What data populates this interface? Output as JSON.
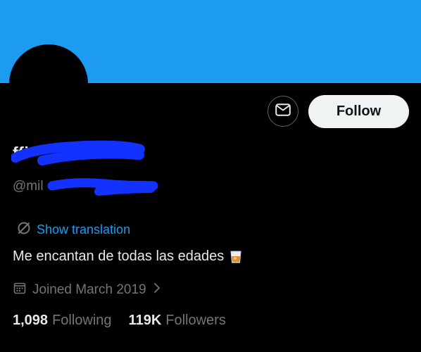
{
  "profile": {
    "display_name": "ffi",
    "handle": "@mil",
    "bio": "Me encantan de todas las edades",
    "translation_link": "Show translation",
    "joined": "Joined March 2019"
  },
  "actions": {
    "follow_label": "Follow",
    "message_icon": "envelope-icon"
  },
  "stats": {
    "following_count": "1,098",
    "following_label": "Following",
    "followers_count": "119K",
    "followers_label": "Followers"
  },
  "colors": {
    "banner": "#1d9bf0",
    "link": "#1d9bf0",
    "redaction": "#1432ff"
  }
}
